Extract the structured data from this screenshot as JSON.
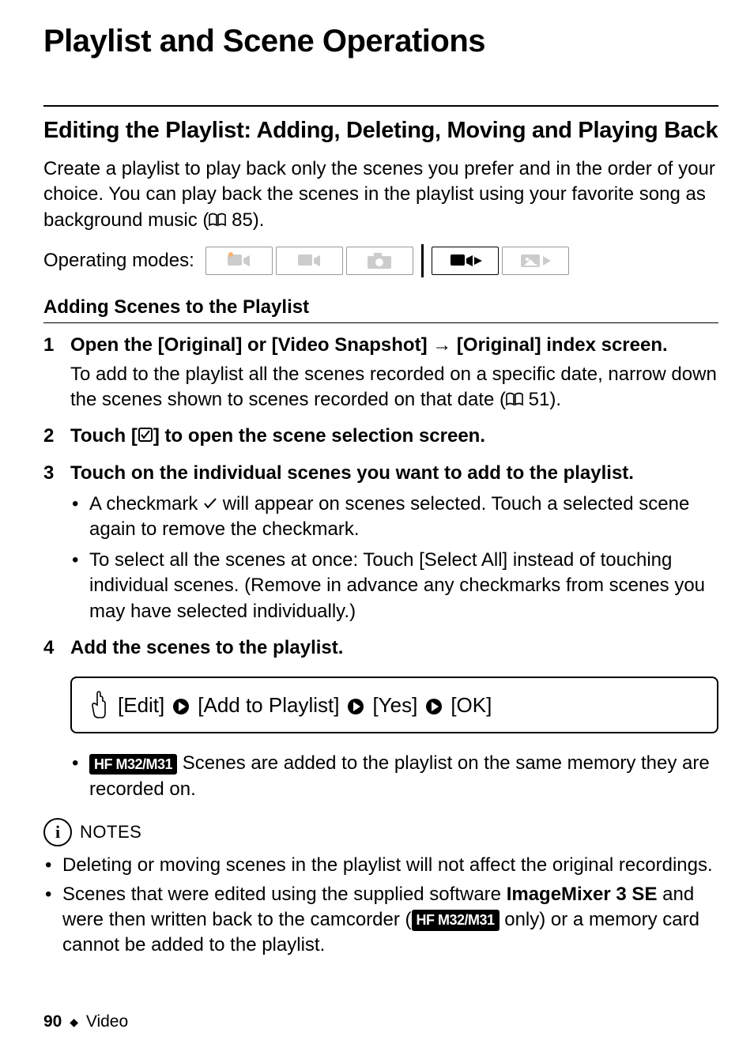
{
  "page_title": "Playlist and Scene Operations",
  "section_title": "Editing the Playlist: Adding, Deleting, Moving and Playing Back",
  "intro_prefix": "Create a playlist to play back only the scenes you prefer and in the order of your choice. You can play back the scenes in the playlist using your favorite song as background music (",
  "intro_ref": " 85).",
  "operating_modes_label": "Operating modes:",
  "sub_heading": "Adding Scenes to the Playlist",
  "steps": {
    "s1_head_a": "Open the [Original] or [Video Snapshot] ",
    "s1_head_b": " [Original] index screen.",
    "s1_body_a": "To add to the playlist all the scenes recorded on a specific date, narrow down the scenes shown to scenes recorded on that date (",
    "s1_body_ref": " 51).",
    "s2_head_a": "Touch [",
    "s2_head_b": "] to open the scene selection screen.",
    "s3_head": "Touch on the individual scenes you want to add to the playlist.",
    "s3_b1_a": "A checkmark ",
    "s3_b1_b": " will appear on scenes selected. Touch a selected scene again to remove the checkmark.",
    "s3_b2": "To select all the scenes at once: Touch [Select All] instead of touching individual scenes. (Remove in advance any checkmarks from scenes you may have selected individually.)",
    "s4_head": "Add the scenes to the playlist."
  },
  "procedure": {
    "p1": "[Edit]",
    "p2": "[Add to Playlist]",
    "p3": "[Yes]",
    "p4": "[OK]"
  },
  "step4_note_a": " Scenes are added to the playlist on the same memory they are recorded on.",
  "model_badge": "HF M32/M31",
  "notes_label": "NOTES",
  "notes": {
    "n1": "Deleting or moving scenes in the playlist will not affect the original recordings.",
    "n2_a": "Scenes that were edited using the supplied software ",
    "n2_b": "ImageMixer 3 SE",
    "n2_c": " and were then written back to the camcorder (",
    "n2_d": " only) or a memory card cannot be added to the playlist."
  },
  "footer": {
    "page": "90",
    "section": "Video"
  }
}
